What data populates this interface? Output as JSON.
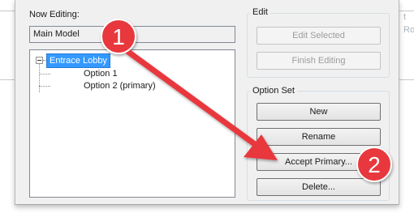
{
  "background": {
    "ghost_right_top": "t",
    "ghost_right_mid": "Ro"
  },
  "dialog": {
    "now_editing_label": "Now Editing:",
    "model_value": "Main Model",
    "tree": {
      "root": "Entrace Lobby",
      "children": [
        "Option 1",
        "Option 2 (primary)"
      ]
    },
    "edit_group": {
      "title": "Edit",
      "buttons": [
        "Edit Selected",
        "Finish Editing"
      ]
    },
    "option_set_group": {
      "title": "Option Set",
      "buttons": [
        "New",
        "Rename",
        "Accept Primary...",
        "Delete..."
      ]
    }
  },
  "annotations": {
    "badge_1": "1",
    "badge_2": "2",
    "accent_color": "#e8383d"
  }
}
